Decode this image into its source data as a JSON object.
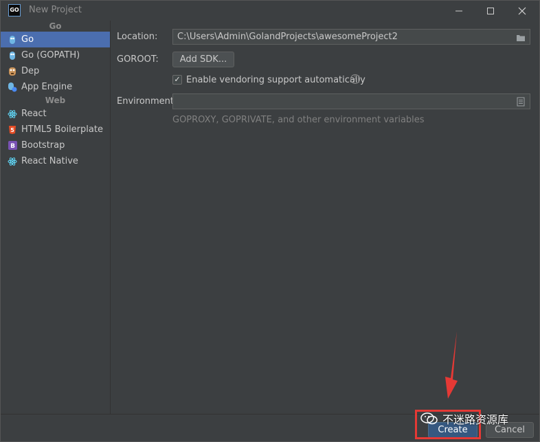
{
  "window": {
    "title": "New Project",
    "app_icon_text": "GO"
  },
  "sidebar": {
    "groups": [
      {
        "label": "Go",
        "items": [
          {
            "label": "Go",
            "icon": "gopher-icon",
            "selected": true
          },
          {
            "label": "Go (GOPATH)",
            "icon": "gopher-icon",
            "selected": false
          },
          {
            "label": "Dep",
            "icon": "dep-icon",
            "selected": false
          },
          {
            "label": "App Engine",
            "icon": "app-engine-icon",
            "selected": false
          }
        ]
      },
      {
        "label": "Web",
        "items": [
          {
            "label": "React",
            "icon": "react-icon",
            "selected": false
          },
          {
            "label": "HTML5 Boilerplate",
            "icon": "html5-icon",
            "selected": false
          },
          {
            "label": "Bootstrap",
            "icon": "bootstrap-icon",
            "selected": false
          },
          {
            "label": "React Native",
            "icon": "react-icon",
            "selected": false
          }
        ]
      }
    ]
  },
  "form": {
    "location_label": "Location:",
    "location_value": "C:\\Users\\Admin\\GolandProjects\\awesomeProject2",
    "goroot_label": "GOROOT:",
    "add_sdk_label": "Add SDK...",
    "vendoring_label": "Enable vendoring support automatically",
    "vendoring_checked": true,
    "environment_label": "Environment:",
    "environment_value": "",
    "environment_hint": "GOPROXY, GOPRIVATE, and other environment variables"
  },
  "footer": {
    "create_label": "Create",
    "cancel_label": "Cancel"
  },
  "watermark": {
    "text": "不迷路资源库"
  },
  "colors": {
    "accent_selected": "#4b6eaf",
    "primary_button": "#365880",
    "highlight": "#e53935"
  }
}
